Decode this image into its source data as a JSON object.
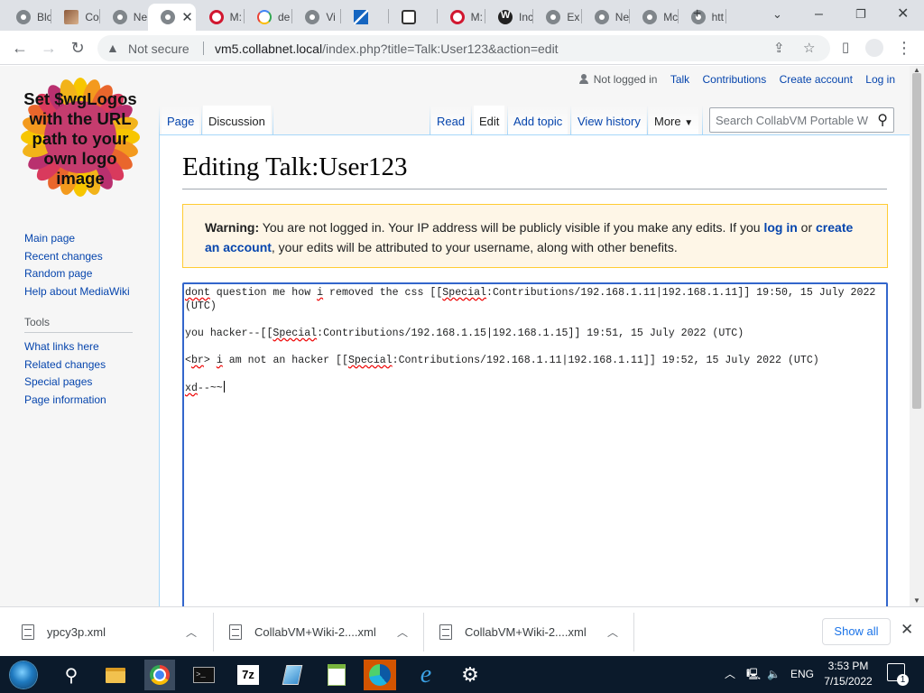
{
  "browser": {
    "tabs": [
      {
        "title": "Blc",
        "icon": "chrome-icon"
      },
      {
        "title": "Co",
        "icon": "profile-photo-icon"
      },
      {
        "title": "Ne",
        "icon": "chrome-icon"
      },
      {
        "title": "",
        "icon": "chrome-icon",
        "active": true
      },
      {
        "title": "M:",
        "icon": "opera-icon"
      },
      {
        "title": "de",
        "icon": "google-icon"
      },
      {
        "title": "Vi",
        "icon": "chrome-icon"
      },
      {
        "title": "",
        "icon": "collabvm-icon"
      },
      {
        "title": "",
        "icon": "robot-icon"
      },
      {
        "title": "M:",
        "icon": "opera-icon"
      },
      {
        "title": "Inc",
        "icon": "wordpress-icon"
      },
      {
        "title": "Ex",
        "icon": "chrome-icon"
      },
      {
        "title": "Ne",
        "icon": "chrome-icon"
      },
      {
        "title": "Mc",
        "icon": "chrome-icon"
      },
      {
        "title": "htt",
        "icon": "chrome-icon"
      }
    ],
    "security_label": "Not secure",
    "url_host": "vm5.collabnet.local",
    "url_rest": "/index.php?title=Talk:User123&action=edit"
  },
  "wiki": {
    "logo_text": "Set $wgLogos with the URL path to your own logo image",
    "sidebar": {
      "nav": [
        "Main page",
        "Recent changes",
        "Random page",
        "Help about MediaWiki"
      ],
      "tools_heading": "Tools",
      "tools": [
        "What links here",
        "Related changes",
        "Special pages",
        "Page information"
      ]
    },
    "personal": {
      "status": "Not logged in",
      "links": [
        "Talk",
        "Contributions",
        "Create account",
        "Log in"
      ]
    },
    "tabs": {
      "page": "Page",
      "discussion": "Discussion",
      "read": "Read",
      "edit": "Edit",
      "add_topic": "Add topic",
      "view_history": "View history",
      "more": "More"
    },
    "search_placeholder": "Search CollabVM Portable W",
    "title": "Editing Talk:User123",
    "warning": {
      "label": "Warning:",
      "text1": "You are not logged in. Your IP address will be publicly visible if you make any edits. If you",
      "log_in": "log in",
      "or": "or",
      "create_account": "create an account",
      "text2": ", your edits will be attributed to your username, along with other benefits."
    },
    "editor_lines": [
      "dont question me how i removed the css [[Special:Contributions/192.168.1.11|192.168.1.11]] 19:50, 15 July 2022 (UTC)",
      "you hacker--[[Special:Contributions/192.168.1.15|192.168.1.15]] 19:51, 15 July 2022 (UTC)",
      "<br> i am not an hacker [[Special:Contributions/192.168.1.11|192.168.1.11]] 19:52, 15 July 2022 (UTC)",
      "xd--~~"
    ]
  },
  "downloads": {
    "items": [
      "ypcy3p.xml",
      "CollabVM+Wiki-2....xml",
      "CollabVM+Wiki-2....xml"
    ],
    "show_all": "Show all"
  },
  "taskbar": {
    "lang": "ENG",
    "time": "3:53 PM",
    "date": "7/15/2022",
    "notifications": "1"
  }
}
